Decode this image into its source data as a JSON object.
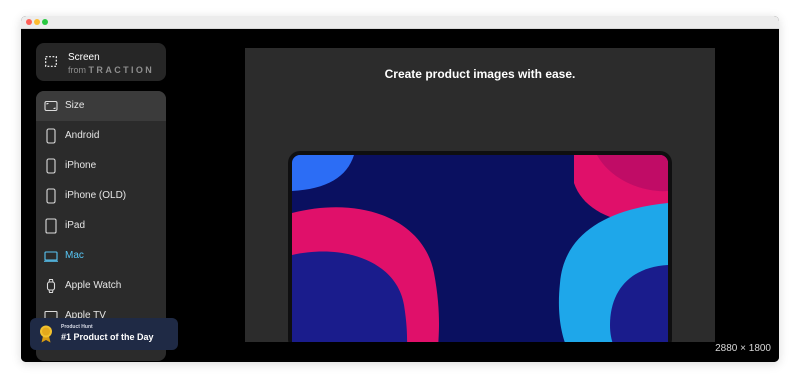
{
  "window": {
    "controls": [
      "close",
      "minimize",
      "zoom"
    ]
  },
  "brand": {
    "title": "Screen",
    "from": "from",
    "name": "TRACTION",
    "icon": "screen-capture-icon"
  },
  "sidebar": {
    "items": [
      {
        "label": "Size",
        "icon": "size-icon",
        "selected": true
      },
      {
        "label": "Android",
        "icon": "phone-icon"
      },
      {
        "label": "iPhone",
        "icon": "phone-icon"
      },
      {
        "label": "iPhone (OLD)",
        "icon": "phone-icon"
      },
      {
        "label": "iPad",
        "icon": "tablet-icon"
      },
      {
        "label": "Mac",
        "icon": "laptop-icon",
        "active": true
      },
      {
        "label": "Apple Watch",
        "icon": "watch-icon"
      },
      {
        "label": "Apple TV",
        "icon": "tv-icon"
      }
    ]
  },
  "canvas": {
    "headline": "Create product images with ease.",
    "device": "Mac"
  },
  "badge": {
    "small": "Product Hunt",
    "big": "#1 Product of the Day",
    "icon": "medal-icon"
  },
  "dimensions": "2880 × 1800",
  "colors": {
    "accent": "#58c6f5",
    "sidebar": "#2b2b2b",
    "canvas": "#2c2c2c",
    "wallpaper_pink": "#e0106a",
    "wallpaper_blue": "#1ea7ea",
    "wallpaper_navy": "#0a1060"
  }
}
